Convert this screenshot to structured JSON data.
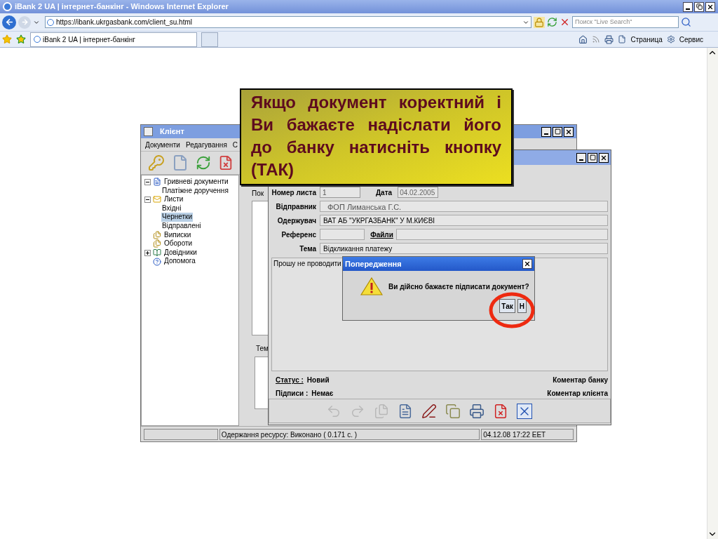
{
  "browser": {
    "title": "iBank 2 UA | інтернет-банкінг - Windows Internet Explorer",
    "url": "https://ibank.ukrgasbank.com/client_su.html",
    "search_placeholder": "Поиск \"Live Search\"",
    "tab": "iBank 2 UA | інтернет-банкінг",
    "commands": [
      "Страница",
      "Сервис"
    ]
  },
  "client_window": {
    "title": "Клієнт",
    "menu": [
      "Документи",
      "Редагування",
      "С"
    ],
    "tree": [
      {
        "label": "Гривневі документи",
        "kind": "document",
        "expanded": true,
        "selected": false,
        "children": [
          {
            "label": "Платіжне доручення",
            "selected": false
          }
        ]
      },
      {
        "label": "Листи",
        "kind": "mail",
        "expanded": true,
        "selected": false,
        "children": [
          {
            "label": "Вхідні",
            "selected": false
          },
          {
            "label": "Чернетки",
            "selected": true
          },
          {
            "label": "Відправлені",
            "selected": false
          }
        ]
      },
      {
        "label": "Виписки",
        "kind": "statement",
        "selected": false
      },
      {
        "label": "Обороти",
        "kind": "statement",
        "selected": false
      },
      {
        "label": "Довідники",
        "kind": "reference",
        "expanded": false,
        "selected": false
      },
      {
        "label": "Допомога",
        "kind": "help",
        "selected": false
      }
    ],
    "pane_labels": [
      "Пок",
      "Тем"
    ],
    "status_bar": {
      "message": "Одержання ресурсу: Виконано ( 0.171 с. )",
      "time": "04.12.08 17:22 EET"
    }
  },
  "document_window": {
    "header": [
      {
        "label": "Номер листа",
        "value": "1"
      },
      {
        "label": "Дата",
        "value": "04.02.2005"
      }
    ],
    "fields": [
      {
        "kind": "text",
        "label": "Відправник",
        "value": "ФОП Лиманська Г.С."
      },
      {
        "kind": "text",
        "label": "Одержувач",
        "value": "ВАТ АБ \"УКРГАЗБАНК\" У М.КИЄВІ"
      },
      {
        "kind": "files",
        "label": "Референс",
        "link": "Файли"
      },
      {
        "kind": "text",
        "label": "Тема",
        "value": "Відкликання платежу"
      }
    ],
    "body": "Прошу не проводити",
    "status": [
      {
        "label": "Статус :",
        "value": "Новий",
        "link": true
      },
      {
        "label": "Підписи :",
        "value": "Немає",
        "link": false
      }
    ],
    "comments": [
      "Коментар банку",
      "Коментар клієнта"
    ],
    "toolbar": [
      {
        "kind": "undo",
        "disabled": true
      },
      {
        "kind": "redo",
        "disabled": true
      },
      {
        "kind": "pages",
        "disabled": true
      },
      {
        "kind": "edit",
        "disabled": false
      },
      {
        "kind": "sign",
        "disabled": false
      },
      {
        "kind": "copy",
        "disabled": false
      },
      {
        "kind": "print",
        "disabled": false
      },
      {
        "kind": "delete",
        "disabled": false
      },
      {
        "kind": "close",
        "disabled": false
      }
    ]
  },
  "dialog": {
    "title": "Попередження",
    "message": "Ви дійсно бажаєте підписати документ?",
    "buttons": [
      "Так",
      "Н"
    ]
  },
  "callout": {
    "text": "Якщо документ коректний і Ви бажаєте надіслати його до банку натисніть кнопку (ТАК)"
  }
}
